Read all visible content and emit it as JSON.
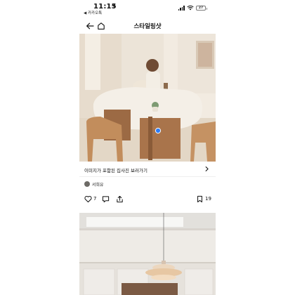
{
  "status_bar": {
    "time": "11:15",
    "back_app": "◀ 카카오톡"
  },
  "nav": {
    "title": "스타일링샷"
  },
  "post": {
    "link_text": "이미지가 포함된 집사진 보러가기",
    "username": "서희유",
    "like_count": "7",
    "bookmark_count": "19"
  },
  "icons": {
    "back": "arrow-left-icon",
    "home": "home-icon",
    "chevron": "chevron-right-icon",
    "like": "heart-icon",
    "comment": "comment-icon",
    "share": "share-icon",
    "bookmark": "bookmark-icon"
  },
  "colors": {
    "accent": "#2d7cf6",
    "background": "#ffffff"
  }
}
